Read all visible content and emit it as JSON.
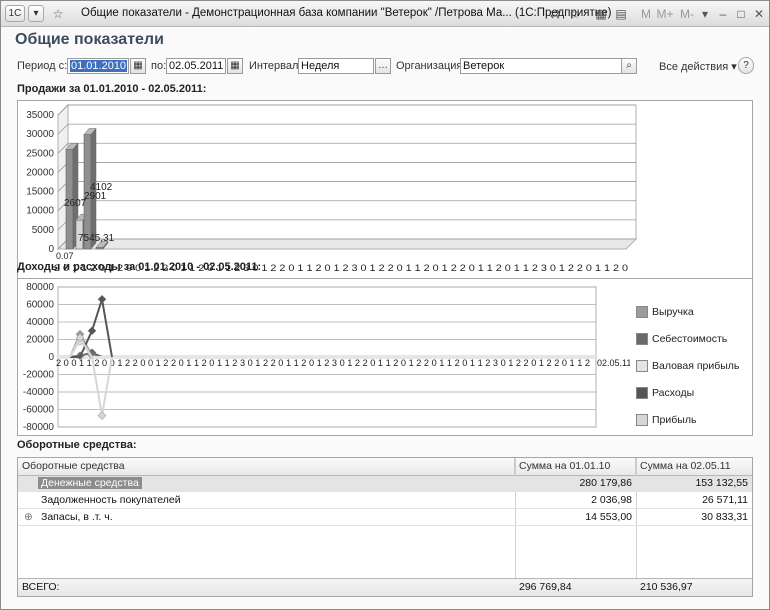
{
  "titlebar": {
    "title": "Общие показатели - Демонстрационная база компании \"Ветерок\" /Петрова Ма...  (1С:Предприятие)",
    "logo": "1С",
    "buttons": [
      "M",
      "M+",
      "M-"
    ]
  },
  "page": {
    "title": "Общие показатели"
  },
  "filters": {
    "period_from_label": "Период с:",
    "period_from_value": "01.01.2010",
    "period_to_label": "по:",
    "period_to_value": "02.05.2011",
    "interval_label": "Интервал:",
    "interval_value": "Неделя",
    "org_label": "Организация:",
    "org_value": "Ветерок",
    "all_actions": "Все действия",
    "help": "?"
  },
  "sales": {
    "title": "Продажи за 01.01.2010 - 02.05.2011:",
    "chart_data": {
      "type": "bar",
      "ylim": [
        0,
        35000
      ],
      "yticks": [
        "35000",
        "30000",
        "25000",
        "20000",
        "15000",
        "10000",
        "5000",
        "0"
      ],
      "values": [
        26070,
        7545,
        29902,
        400
      ],
      "data_labels": [
        "2607",
        "7545,31",
        "2901",
        "4102"
      ],
      "category_marks": "2 0 1 1 2 0 1 2 0 0 1 2 2 0 1 1 2 0 1 1 2 3 0 1 2 2 0 1 1 2 0 1 2 3 0 1 2 2 0 1 1 2 0 1 2 2 0 1 1 2 0 1 1 2 3 0 1 2 2 0 1 1 2 0",
      "first_label": "0.07"
    }
  },
  "finance": {
    "title": "Доходы и расходы за 01.01.2010 - 02.05.2011:",
    "chart_data": {
      "type": "line",
      "ylim": [
        -80000,
        80000
      ],
      "yticks": [
        "80000",
        "60000",
        "40000",
        "20000",
        "0",
        "-20000",
        "-40000",
        "-60000",
        "-80000"
      ],
      "end_label": "02.05.11",
      "category_marks": "2 0 0 1 1 2 0 0 1 2 2 0 0 1 2 2 0 1 1 2 0 1 1 2 3 0 1 2 2 0 1 1 2 0 1 2 3 0 1 2 2 0 1 1 2 0 1 2 2 0 1 1 2 0 1 1 2 3 0 1 2 2 0 1 2 2 0 1 1 2",
      "series": [
        {
          "name": "Выручка",
          "color": "#9c9c9c",
          "values": [
            0,
            26000,
            2000,
            0,
            0
          ]
        },
        {
          "name": "Себестоимость",
          "color": "#6a6a6a",
          "values": [
            0,
            1500,
            5000,
            0,
            0
          ]
        },
        {
          "name": "Валовая прибыль",
          "color": "#e4e4e4",
          "values": [
            0,
            18000,
            0,
            0,
            0
          ]
        },
        {
          "name": "Расходы",
          "color": "#555555",
          "values": [
            0,
            0,
            30000,
            66000,
            0
          ]
        },
        {
          "name": "Прибыль",
          "color": "#d6d6d6",
          "values": [
            0,
            22000,
            0,
            -67000,
            0
          ]
        }
      ]
    }
  },
  "assets": {
    "title": "Оборотные средства:",
    "columns": [
      "Оборотные средства",
      "Сумма на 01.01.10",
      "Сумма на 02.05.11"
    ],
    "rows": [
      {
        "name": "Денежные средства",
        "v1": "280 179,86",
        "v2": "153 132,55",
        "selected": true
      },
      {
        "name": "Задолженность покупателей",
        "v1": "2 036,98",
        "v2": "26 571,11"
      },
      {
        "name": "Запасы, в .т. ч.",
        "v1": "14 553,00",
        "v2": "30 833,31",
        "expand": "⊕"
      }
    ],
    "total_label": "ВСЕГО:",
    "total_v1": "296 769,84",
    "total_v2": "210 536,97"
  }
}
